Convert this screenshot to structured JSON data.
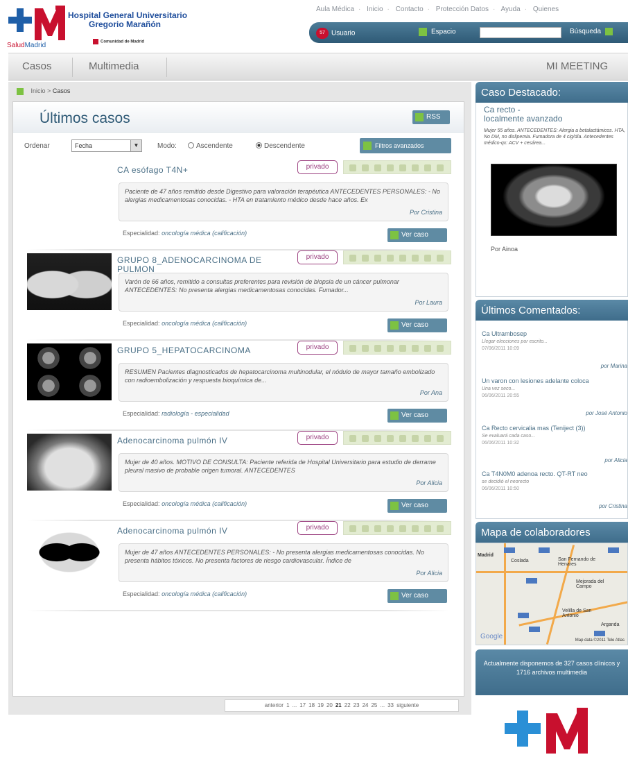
{
  "brand": {
    "name_line1": "Hospital General Universitario",
    "name_line2": "Gregorio Marañón",
    "salud": "Salud",
    "madrid": "Madrid",
    "comunidad": "Comunidad de Madrid"
  },
  "toplinks": [
    "Aula Médica",
    "Inicio",
    "Contacto",
    "Protección Datos",
    "Ayuda",
    "Quienes"
  ],
  "userbar": {
    "notifications_badge": "57",
    "user_label": "Usuario",
    "espacio_label": "Espacio",
    "search_value": "",
    "search_label": "Búsqueda"
  },
  "nav": {
    "casos": "Casos",
    "multimedia": "Multimedia",
    "mimeeting": "MI MEETING"
  },
  "breadcrumb": {
    "home": "Inicio",
    "separator": ">",
    "current": "Casos"
  },
  "main": {
    "title": "Últimos casos",
    "rss_label": "RSS",
    "sort_label": "Ordenar",
    "sort_value": "Fecha",
    "mode_label": "Modo:",
    "mode_asc": "Ascendente",
    "mode_desc": "Descendente",
    "mode_selected": "Descendente",
    "filter_label": "Filtros avanzados"
  },
  "cases": [
    {
      "title": "CA esófago T4N+",
      "badge": "privado",
      "rating": 0,
      "description": "Paciente de 47 años remitido desde Digestivo para valoración terapéutica ANTECEDENTES PERSONALES: - No alergias medicamentosas conocidas. - HTA en tratamiento médico desde hace años. Ex",
      "author": "Por Cristina",
      "specialty_label": "Especialidad:",
      "specialty": "oncología médica (calificación)",
      "view_label": "Ver caso",
      "thumb": "none"
    },
    {
      "title": "GRUPO 8_ADENOCARCINOMA DE PULMON",
      "badge": "privado",
      "rating": 0,
      "description": "Varón de 66 años, remitido a consultas preferentes para revisión de biopsia de un cáncer pulmonar ANTECEDENTES: No presenta alergias medicamentosas conocidas. Fumador...",
      "author": "Por Laura",
      "specialty_label": "Especialidad:",
      "specialty": "oncología médica (calificación)",
      "view_label": "Ver caso",
      "thumb": "chest-xray"
    },
    {
      "title": "GRUPO 5_HEPATOCARCINOMA",
      "badge": "privado",
      "rating": 0,
      "description": "RESUMEN Pacientes diagnosticados de hepatocarcinoma multinodular, el nódulo de mayor tamaño embolizado con radioembolización y respuesta bioquímica de...",
      "author": "Por Ana",
      "specialty_label": "Especialidad:",
      "specialty": "radiología - especialidad",
      "view_label": "Ver caso",
      "thumb": "ct-grid"
    },
    {
      "title": "Adenocarcinoma pulmón IV",
      "badge": "privado",
      "rating": 0,
      "description": "Mujer de 40 años. MOTIVO DE CONSULTA: Paciente referida de Hospital Universitario para estudio de derrame pleural masivo de probable origen tumoral. ANTECEDENTES",
      "author": "Por Alicia",
      "specialty_label": "Especialidad:",
      "specialty": "oncología médica (calificación)",
      "view_label": "Ver caso",
      "thumb": "xray"
    },
    {
      "title": "Adenocarcinoma pulmón IV",
      "badge": "privado",
      "rating": 0,
      "description": "Mujer de 47 años ANTECEDENTES PERSONALES: - No presenta alergias medicamentosas conocidas. No presenta hábitos tóxicos. No presenta factores de riesgo cardiovascular. Índice de",
      "author": "Por Alicia",
      "specialty_label": "Especialidad:",
      "specialty": "oncología médica (calificación)",
      "view_label": "Ver caso",
      "thumb": "ct-lung"
    }
  ],
  "pager": {
    "prev": "anterior",
    "pages": [
      "1",
      "...",
      "17",
      "18",
      "19",
      "20",
      "21",
      "22",
      "23",
      "24",
      "25",
      "...",
      "33"
    ],
    "current": "21",
    "next": "siguiente"
  },
  "sidebar": {
    "featured": {
      "heading": "Caso Destacado:",
      "title_line1": "Ca recto -",
      "title_line2": "localmente avanzado",
      "description": "Mujer 55 años. ANTECEDENTES: Alergia a betalactámicos. HTA, No DM, no dislipemia. Fumadora de 4 cig/día. Antecedentes médico-qx: ACV + cesárea...",
      "author": "Por Ainoa"
    },
    "comments": {
      "heading": "Últimos Comentados:",
      "items": [
        {
          "title": "Ca Ultrambosep",
          "snippet": "Llegar elecciones por escrito...",
          "date": "07/06/2011 10:09",
          "author": "por Marina"
        },
        {
          "title": "Un varon con lesiones adelante coloca",
          "snippet": "Una vez seco...",
          "date": "06/06/2011 20:55",
          "author": "por José Antonio"
        },
        {
          "title": "Ca Recto cervicalia mas (Teniject (3))",
          "snippet": "Se evaluará cada caso...",
          "date": "06/06/2011 10:32",
          "author": "por Alicia"
        },
        {
          "title": "Ca T4N0M0 adenoa recto. QT-RT neo",
          "snippet": "se decidió el neorecto",
          "date": "06/06/2011 10:50",
          "author": "por Cristina"
        }
      ]
    },
    "map": {
      "heading": "Mapa de colaboradores",
      "labels": [
        "Madrid",
        "Coslada",
        "San Fernando de Henares",
        "Mejorada del Campo",
        "Velilla de San Antonio",
        "Arganda"
      ],
      "google": "Google",
      "copyright": "Map data ©2011 Tele Atlas"
    },
    "available": "Actualmente disponemos de 327 casos clínicos y 1716 archivos multimedia"
  },
  "colors": {
    "accent": "#5f8ba3",
    "title": "#2f5a76",
    "badge": "#9a3d7e",
    "green": "#7dc242",
    "brand_red": "#c8102e"
  }
}
